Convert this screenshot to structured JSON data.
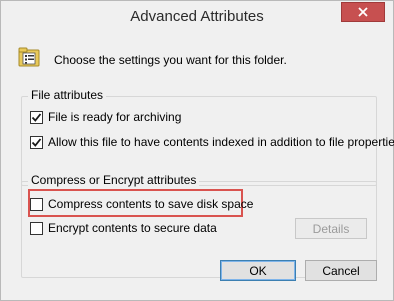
{
  "window": {
    "title": "Advanced Attributes"
  },
  "header": {
    "text": "Choose the settings you want for this folder."
  },
  "file_attributes": {
    "label": "File attributes",
    "items": [
      {
        "label": "File is ready for archiving",
        "checked": true
      },
      {
        "label": "Allow this file to have contents indexed in addition to file properties",
        "checked": true
      }
    ]
  },
  "compress_encrypt": {
    "label": "Compress or Encrypt attributes",
    "items": [
      {
        "label": "Compress contents to save disk space",
        "checked": false
      },
      {
        "label": "Encrypt contents to secure data",
        "checked": false
      }
    ],
    "details_label": "Details"
  },
  "buttons": {
    "ok": "OK",
    "cancel": "Cancel"
  },
  "colors": {
    "close_button": "#c75050",
    "highlight": "#d9534f"
  },
  "icons": {
    "folder_settings": "folder-settings-icon",
    "close": "close-icon",
    "checkmark": "checkmark-icon"
  }
}
